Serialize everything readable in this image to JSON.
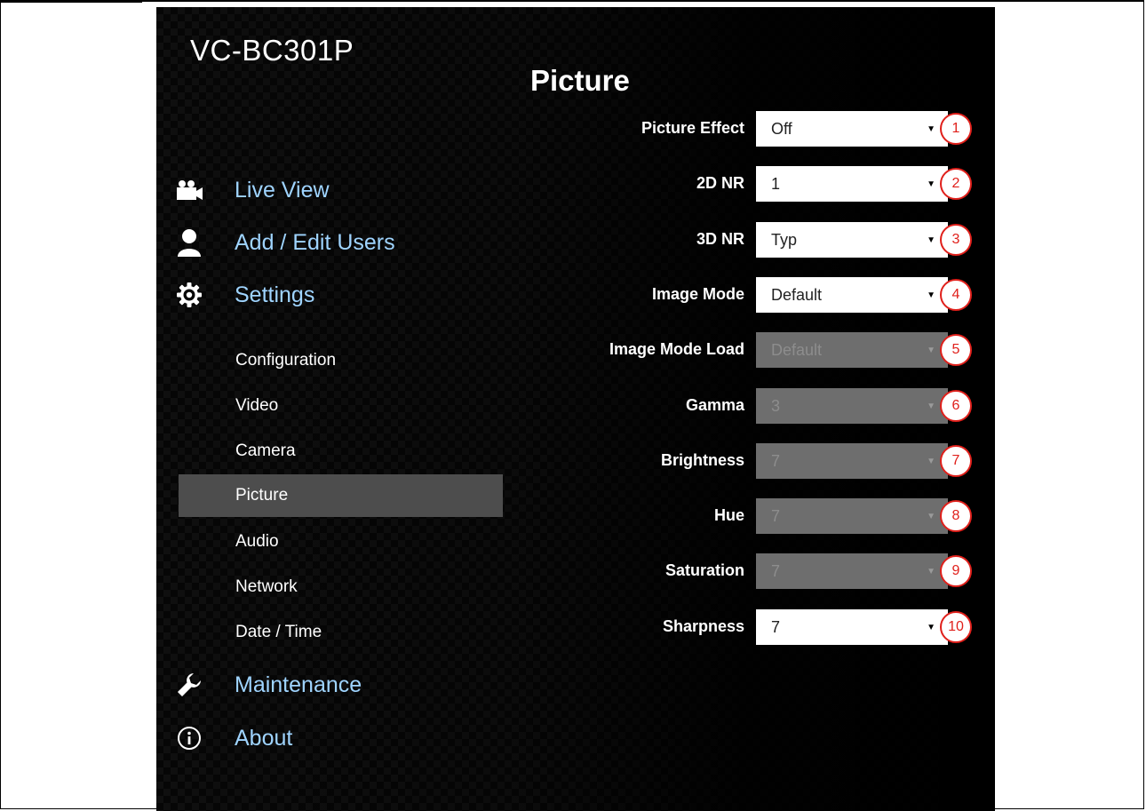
{
  "app": {
    "title": "VC-BC301P"
  },
  "nav": {
    "live_view": "Live View",
    "add_edit_users": "Add / Edit Users",
    "settings": "Settings",
    "maintenance": "Maintenance",
    "about": "About"
  },
  "settings_menu": [
    {
      "label": "Configuration",
      "active": false
    },
    {
      "label": "Video",
      "active": false
    },
    {
      "label": "Camera",
      "active": false
    },
    {
      "label": "Picture",
      "active": true
    },
    {
      "label": "Audio",
      "active": false
    },
    {
      "label": "Network",
      "active": false
    },
    {
      "label": "Date / Time",
      "active": false
    }
  ],
  "page": {
    "heading": "Picture"
  },
  "fields": [
    {
      "label": "Picture Effect",
      "value": "Off",
      "enabled": true,
      "marker": "1"
    },
    {
      "label": "2D NR",
      "value": "1",
      "enabled": true,
      "marker": "2"
    },
    {
      "label": "3D NR",
      "value": "Typ",
      "enabled": true,
      "marker": "3"
    },
    {
      "label": "Image Mode",
      "value": "Default",
      "enabled": true,
      "marker": "4"
    },
    {
      "label": "Image Mode Load",
      "value": "Default",
      "enabled": false,
      "marker": "5"
    },
    {
      "label": "Gamma",
      "value": "3",
      "enabled": false,
      "marker": "6"
    },
    {
      "label": "Brightness",
      "value": "7",
      "enabled": false,
      "marker": "7"
    },
    {
      "label": "Hue",
      "value": "7",
      "enabled": false,
      "marker": "8"
    },
    {
      "label": "Saturation",
      "value": "7",
      "enabled": false,
      "marker": "9"
    },
    {
      "label": "Sharpness",
      "value": "7",
      "enabled": true,
      "marker": "10"
    }
  ],
  "icons": {
    "live_view": "video-camera-icon",
    "users": "user-icon",
    "settings": "gear-icon",
    "maintenance": "wrench-icon",
    "about": "info-icon",
    "dropdown": "caret-down-icon"
  },
  "colors": {
    "nav_link": "#9fd4ff",
    "active_item_bg": "#4d4d4d",
    "disabled_select_bg": "#6e6e6e",
    "marker": "#e0201b"
  }
}
